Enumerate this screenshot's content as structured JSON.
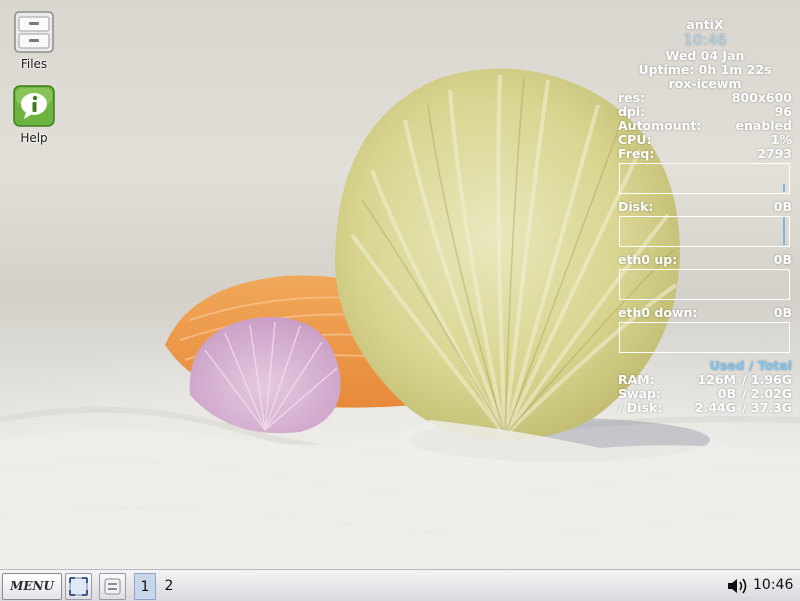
{
  "desktop": {
    "icons": [
      {
        "label": "Files",
        "icon": "file-cabinet-icon"
      },
      {
        "label": "Help",
        "icon": "help-icon"
      }
    ]
  },
  "conky": {
    "distro": "antiX",
    "clock": "10:46",
    "date": "Wed 04 Jan",
    "uptime": "Uptime: 0h 1m 22s",
    "wm": "rox-icewm",
    "stats": [
      {
        "label": "res:",
        "value": "800x600"
      },
      {
        "label": "dpi:",
        "value": "96"
      },
      {
        "label": "Automount:",
        "value": "enabled"
      },
      {
        "label": "CPU:",
        "value": "1%"
      },
      {
        "label": "Freq:",
        "value": "2793"
      }
    ],
    "disk": {
      "label": "Disk:",
      "value": "0B"
    },
    "eth_up": {
      "label": "eth0 up:",
      "value": "0B"
    },
    "eth_down": {
      "label": "eth0 down:",
      "value": "0B"
    },
    "mem_header": "Used / Total",
    "mem": [
      {
        "label": "RAM:",
        "used": "126M",
        "total": "/ 1.96G"
      },
      {
        "label": "Swap:",
        "used": "0B",
        "total": "/ 2.02G"
      },
      {
        "label": "/ Disk:",
        "used": "2.44G",
        "total": "/ 37.3G"
      }
    ],
    "colors": {
      "text": "#ffffff",
      "accent": "#7cc3f0",
      "clock": "#a9d2ec"
    }
  },
  "taskbar": {
    "menu_label": "MENU",
    "show_desktop_icon": "show-desktop-icon",
    "launcher_icon": "file-manager-icon",
    "workspaces": [
      "1",
      "2"
    ],
    "active_workspace": "1",
    "volume_icon": "speaker-icon",
    "clock": "10:46"
  }
}
